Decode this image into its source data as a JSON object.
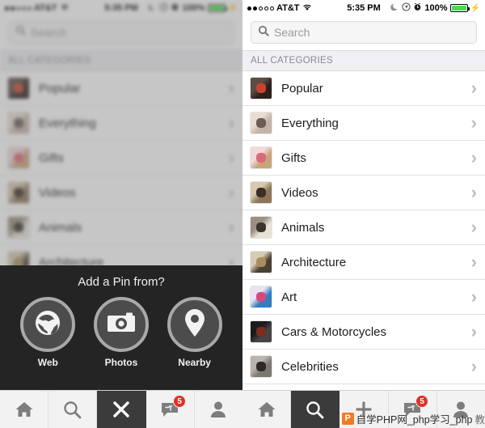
{
  "status_bar": {
    "signal_dots": [
      true,
      true,
      false,
      false,
      false
    ],
    "carrier": "AT&T",
    "wifi_icon": "wifi-icon",
    "time": "5:35 PM",
    "moon_icon": "moon-icon",
    "location_icon": "location-icon",
    "alarm_icon": "alarm-icon",
    "battery_percent": "100%",
    "battery_color": "#44e04a",
    "charging_icon": "lightning-bolt-icon"
  },
  "search": {
    "icon": "search-icon",
    "placeholder": "Search",
    "value": ""
  },
  "categories_header": "ALL CATEGORIES",
  "categories": [
    {
      "label": "Popular",
      "thumb": "popular-thumbnail",
      "c1": "#5e4c44",
      "c2": "#c9442f",
      "c3": "#2a211d",
      "chevron": "chevron-right-icon"
    },
    {
      "label": "Everything",
      "thumb": "everything-thumbnail",
      "c1": "#e7ddd2",
      "c2": "#6d5c55",
      "c3": "#c4b3a6",
      "chevron": "chevron-right-icon"
    },
    {
      "label": "Gifts",
      "thumb": "gifts-thumbnail",
      "c1": "#f3d9d9",
      "c2": "#d96a7a",
      "c3": "#caa37a",
      "chevron": "chevron-right-icon"
    },
    {
      "label": "Videos",
      "thumb": "videos-thumbnail",
      "c1": "#d8c8ad",
      "c2": "#3a2f26",
      "c3": "#8c7558",
      "chevron": "chevron-right-icon"
    },
    {
      "label": "Animals",
      "thumb": "animals-thumbnail",
      "c1": "#9a8f80",
      "c2": "#3b332c",
      "c3": "#e8e2d8",
      "chevron": "chevron-right-icon"
    },
    {
      "label": "Architecture",
      "thumb": "architecture-thumbnail",
      "c1": "#d7cbb4",
      "c2": "#a98f5e",
      "c3": "#4a4135",
      "chevron": "chevron-right-icon"
    },
    {
      "label": "Art",
      "thumb": "art-thumbnail",
      "c1": "#e9e3ef",
      "c2": "#d8487f",
      "c3": "#2f7ec2",
      "chevron": "chevron-right-icon"
    },
    {
      "label": "Cars & Motorcycles",
      "thumb": "cars-thumbnail",
      "c1": "#1b1b1b",
      "c2": "#7e2b22",
      "c3": "#454545",
      "chevron": "chevron-right-icon"
    },
    {
      "label": "Celebrities",
      "thumb": "celebrities-thumbnail",
      "c1": "#b9b4ae",
      "c2": "#2c2a28",
      "c3": "#7c7771",
      "chevron": "chevron-right-icon"
    },
    {
      "label": "",
      "thumb": "partial-thumbnail",
      "c1": "#d8d8d8",
      "c2": "#bdbdbd",
      "c3": "#e6e6e6",
      "chevron": ""
    }
  ],
  "add_pin_sheet": {
    "title": "Add a Pin from?",
    "options": [
      {
        "label": "Web",
        "icon": "globe-icon"
      },
      {
        "label": "Photos",
        "icon": "camera-icon"
      },
      {
        "label": "Nearby",
        "icon": "map-pin-icon"
      }
    ]
  },
  "tab_bar": {
    "tabs": [
      {
        "name": "home",
        "icon": "home-icon",
        "active": false,
        "badge": ""
      },
      {
        "name": "search",
        "icon": "search-icon",
        "active": false,
        "badge": ""
      },
      {
        "name": "add",
        "icon": "close-x-icon",
        "active": true,
        "badge": ""
      },
      {
        "name": "messages",
        "icon": "chat-bubble-icon",
        "active": false,
        "badge": "5"
      },
      {
        "name": "profile",
        "icon": "person-icon",
        "active": false,
        "badge": ""
      }
    ],
    "right_tabs": [
      {
        "name": "home",
        "icon": "home-icon",
        "active": false,
        "badge": ""
      },
      {
        "name": "search",
        "icon": "search-icon",
        "active": true,
        "badge": ""
      },
      {
        "name": "add",
        "icon": "plus-icon",
        "active": false,
        "badge": ""
      },
      {
        "name": "messages",
        "icon": "chat-bubble-icon",
        "active": false,
        "badge": "5"
      },
      {
        "name": "profile",
        "icon": "person-icon",
        "active": false,
        "badge": ""
      }
    ],
    "badge_color": "#e03127",
    "active_color": "#3b3b3b"
  },
  "watermark": {
    "logo_letter": "P",
    "logo_color": "#f07b22",
    "text": "自学PHP网_php学习_php",
    "tail": "教"
  }
}
